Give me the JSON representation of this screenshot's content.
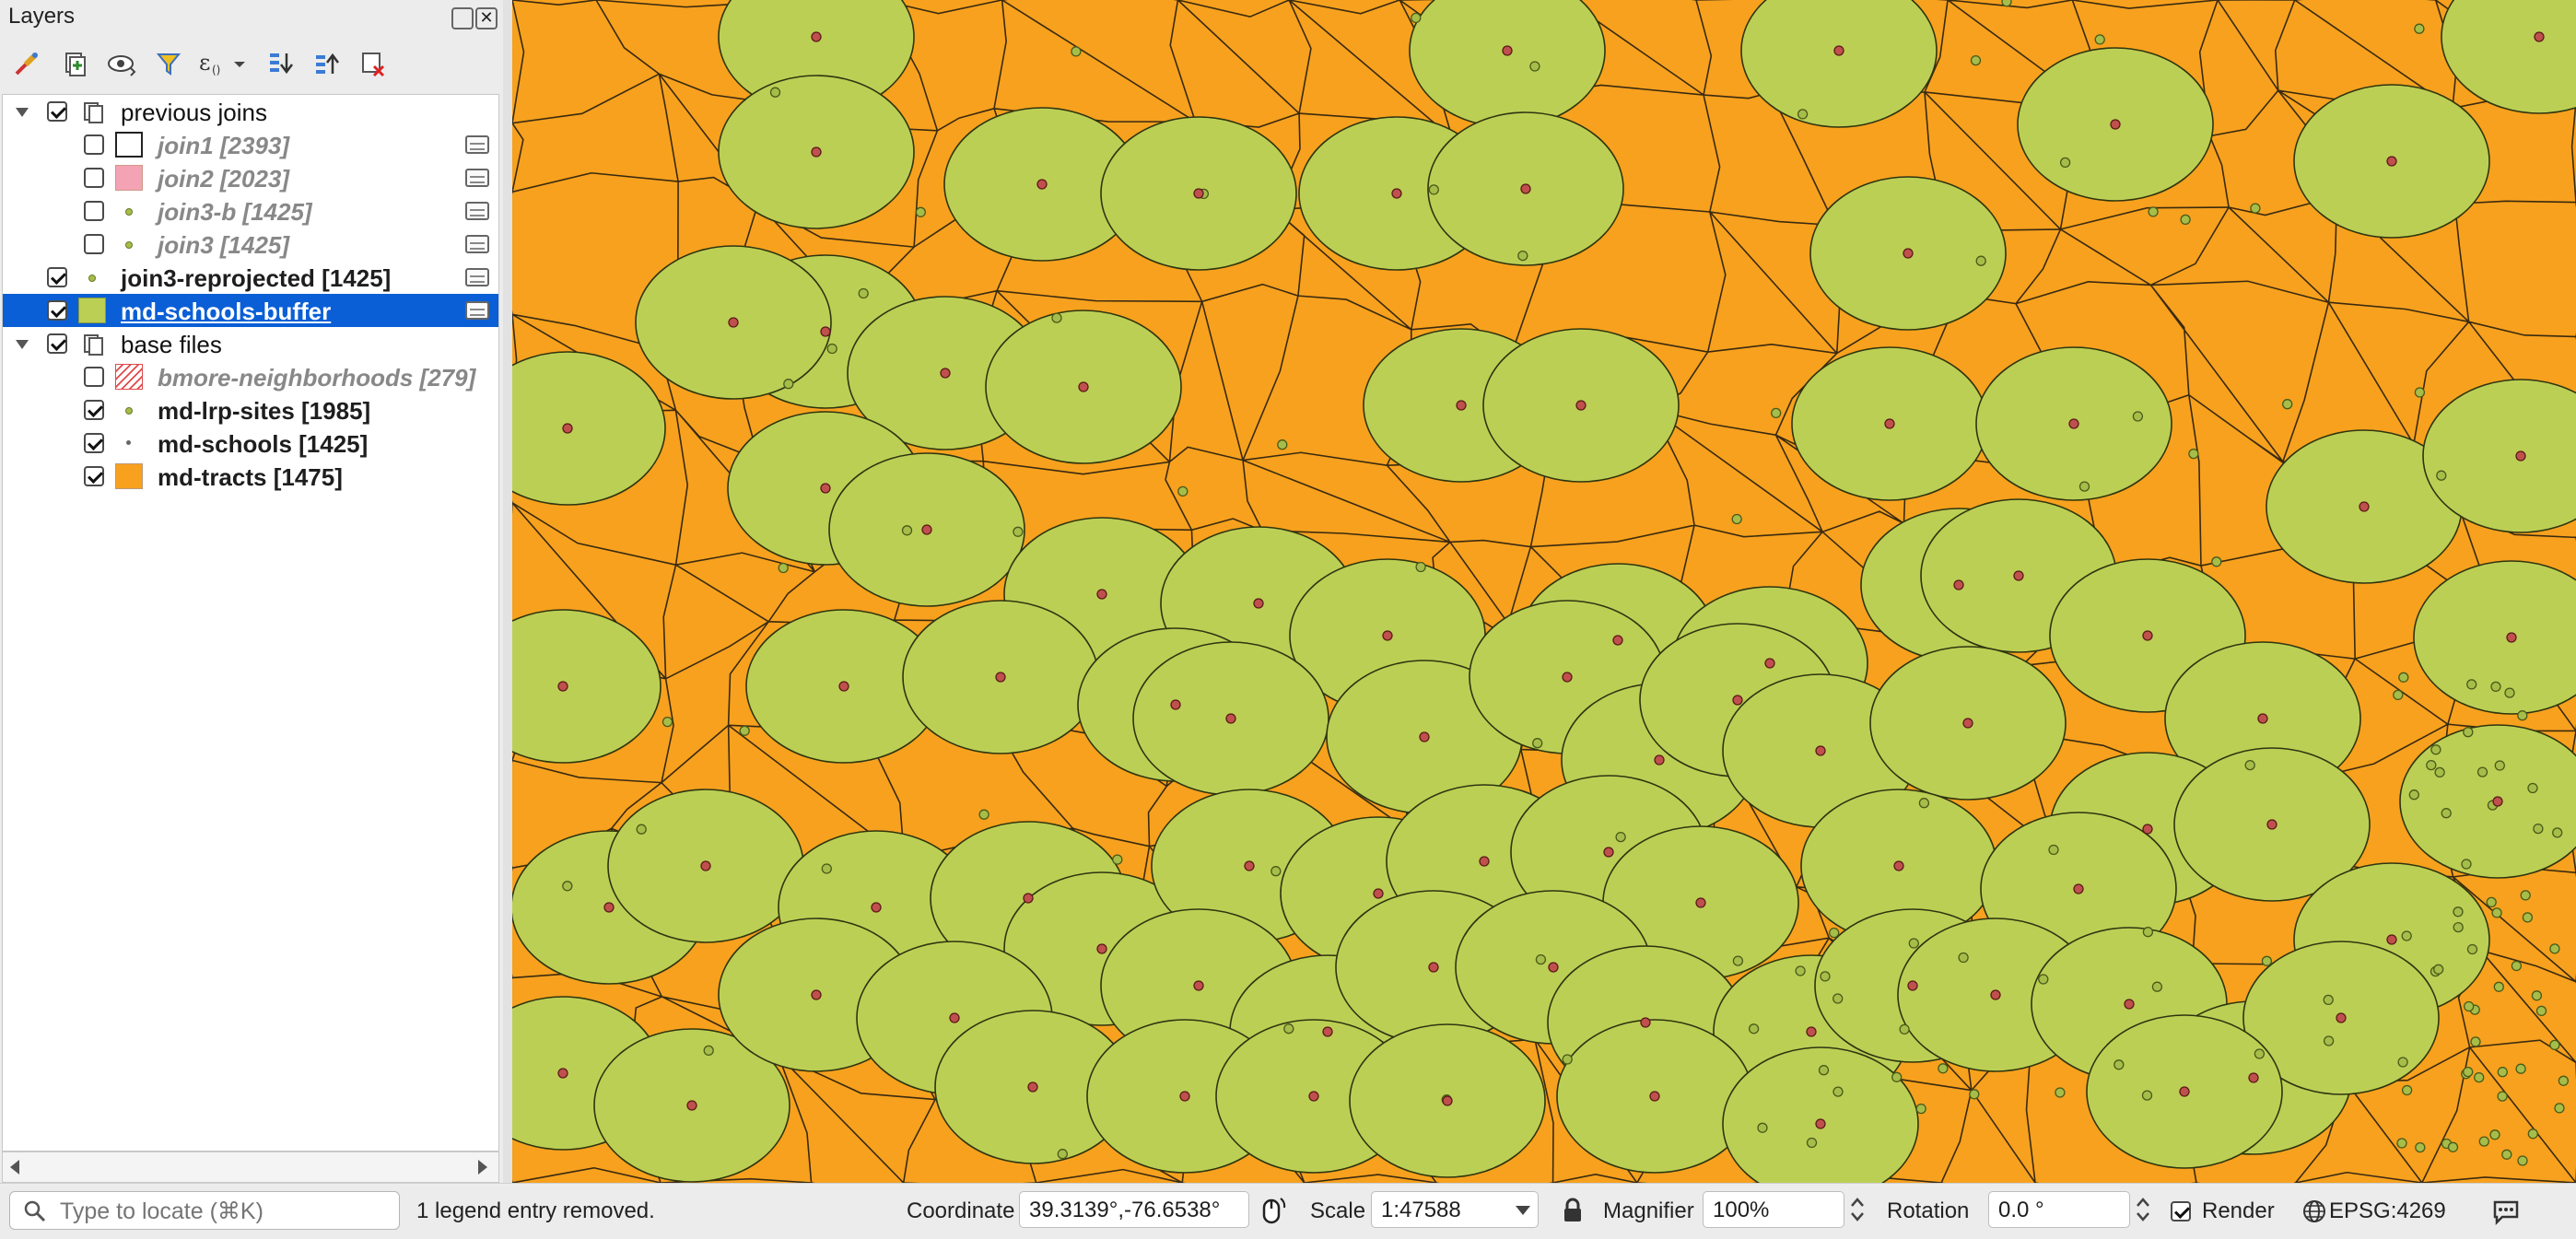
{
  "panel": {
    "title": "Layers"
  },
  "toolbar": {
    "tools": [
      "style-brush-icon",
      "add-group-icon",
      "eye-visibility-icon",
      "filter-funnel-icon",
      "expression-filter-icon",
      "expand-all-icon",
      "collapse-all-icon",
      "remove-layer-icon"
    ]
  },
  "layers": [
    {
      "label": "previous joins",
      "type": "group",
      "checked": true,
      "indent": 0,
      "expanded": true
    },
    {
      "label": "join1 [2393]",
      "type": "layer",
      "checked": false,
      "indent": 1,
      "style": "italic",
      "symbol": "empty-square",
      "memory": true
    },
    {
      "label": "join2 [2023]",
      "type": "layer",
      "checked": false,
      "indent": 1,
      "style": "italic",
      "symbol": "pink-square",
      "memory": true
    },
    {
      "label": "join3-b [1425]",
      "type": "layer",
      "checked": false,
      "indent": 1,
      "style": "italic",
      "symbol": "olive-dot",
      "memory": true
    },
    {
      "label": "join3 [1425]",
      "type": "layer",
      "checked": false,
      "indent": 1,
      "style": "italic",
      "symbol": "olive-dot",
      "memory": true
    },
    {
      "label": "join3-reprojected [1425]",
      "type": "layer",
      "checked": true,
      "indent": 0,
      "style": "bold",
      "symbol": "olive-dot",
      "memory": true
    },
    {
      "label": "md-schools-buffer",
      "type": "layer",
      "checked": true,
      "indent": 0,
      "style": "bold",
      "symbol": "green-square",
      "memory": true,
      "selected": true
    },
    {
      "label": "base files",
      "type": "group",
      "checked": true,
      "indent": 0,
      "expanded": true
    },
    {
      "label": "bmore-neighborhoods [279]",
      "type": "layer",
      "checked": false,
      "indent": 1,
      "style": "italic",
      "symbol": "hatched-square"
    },
    {
      "label": "md-lrp-sites [1985]",
      "type": "layer",
      "checked": true,
      "indent": 1,
      "style": "bold",
      "symbol": "olive-dot"
    },
    {
      "label": "md-schools [1425]",
      "type": "layer",
      "checked": true,
      "indent": 1,
      "style": "bold",
      "symbol": "small-dot"
    },
    {
      "label": "md-tracts [1475]",
      "type": "layer",
      "checked": true,
      "indent": 1,
      "style": "bold",
      "symbol": "orange-square"
    }
  ],
  "colors": {
    "tracts_fill": "#f7a11e",
    "buffer_fill": "#bccf55",
    "school_point": "#c0504d",
    "lrp_point": "#a6bd4a",
    "selection": "#0a5fd6"
  },
  "status": {
    "locator_placeholder": "Type to locate (⌘K)",
    "message": "1 legend entry removed.",
    "coordinate_label": "Coordinate",
    "coordinate_value": "39.3139°,-76.6538°",
    "scale_label": "Scale",
    "scale_value": "1:47588",
    "magnifier_label": "Magnifier",
    "magnifier_value": "100%",
    "rotation_label": "Rotation",
    "rotation_value": "0.0 °",
    "render_label": "Render",
    "render_checked": true,
    "crs": "EPSG:4269"
  }
}
